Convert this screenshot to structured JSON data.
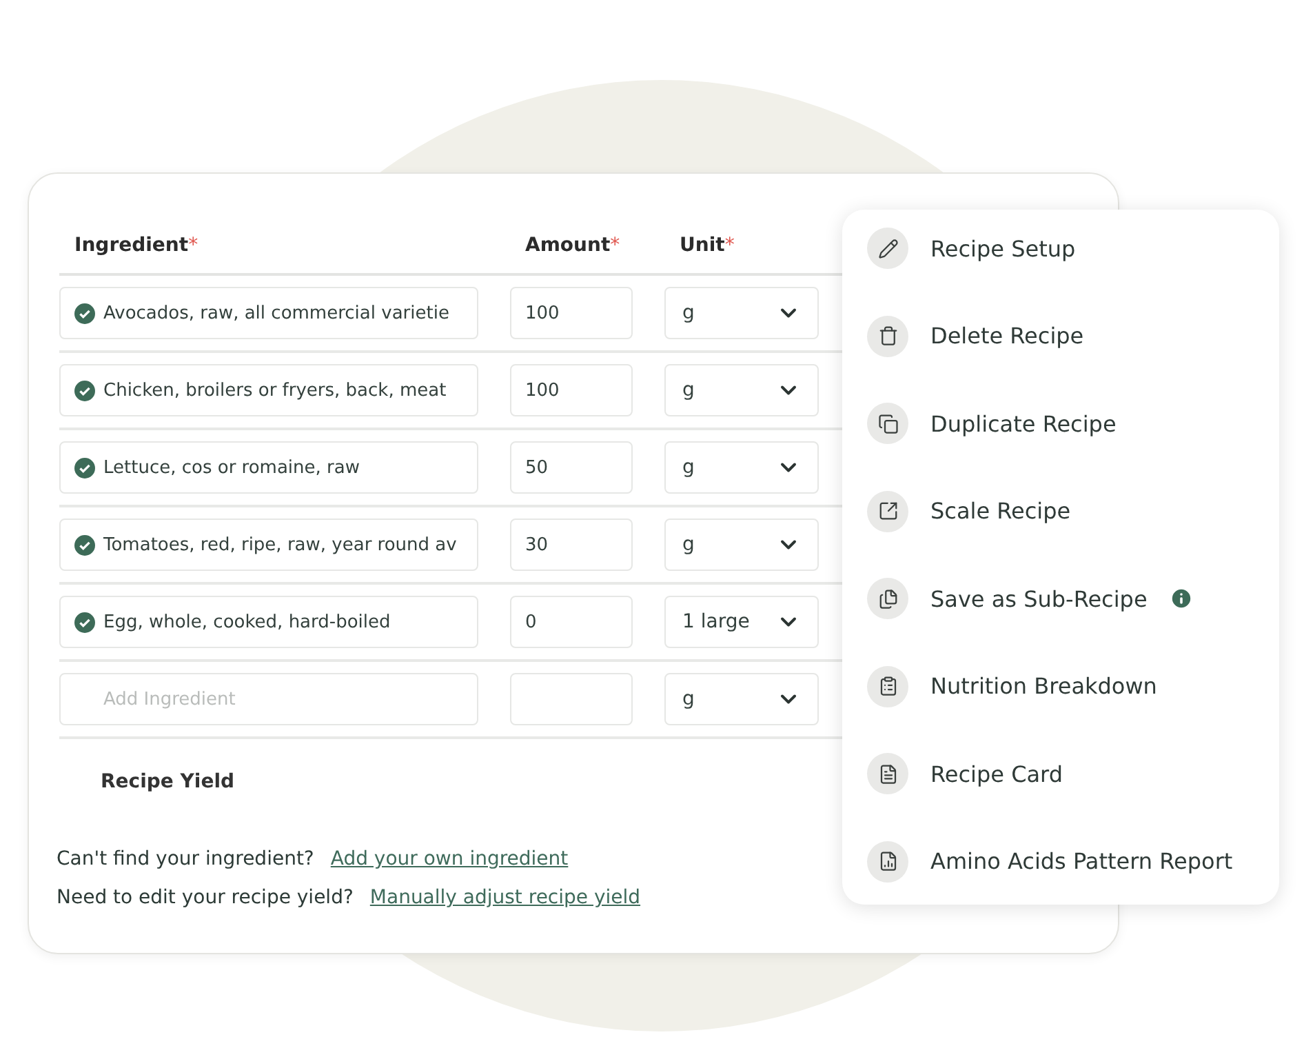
{
  "columns": [
    {
      "label": "Ingredient",
      "mark": "*"
    },
    {
      "label": "Amount",
      "mark": "*"
    },
    {
      "label": "Unit",
      "mark": "*"
    }
  ],
  "rows": [
    {
      "ingredient": "Avocados, raw, all commercial varietie",
      "verified": true,
      "amount": "100",
      "unit": "g"
    },
    {
      "ingredient": "Chicken, broilers or fryers, back, meat",
      "verified": true,
      "amount": "100",
      "unit": "g"
    },
    {
      "ingredient": "Lettuce, cos or romaine, raw",
      "verified": true,
      "amount": "50",
      "unit": "g"
    },
    {
      "ingredient": "Tomatoes, red, ripe, raw, year round av",
      "verified": true,
      "amount": "30",
      "unit": "g"
    },
    {
      "ingredient": "Egg, whole, cooked, hard-boiled",
      "verified": true,
      "amount": "0",
      "unit": "1 large"
    }
  ],
  "new_row": {
    "placeholder": "Add Ingredient",
    "unit": "g"
  },
  "yield_label": "Recipe Yield",
  "help": [
    {
      "question": "Can't find your ingredient?",
      "link": "Add your own ingredient"
    },
    {
      "question": "Need to edit your recipe yield?",
      "link": "Manually adjust recipe yield"
    }
  ],
  "menu": [
    {
      "label": "Recipe Setup"
    },
    {
      "label": "Delete Recipe"
    },
    {
      "label": "Duplicate Recipe"
    },
    {
      "label": "Scale Recipe"
    },
    {
      "label": "Save as Sub-Recipe",
      "info": true
    },
    {
      "label": "Nutrition Breakdown"
    },
    {
      "label": "Recipe Card"
    },
    {
      "label": "Amino Acids Pattern Report"
    }
  ]
}
